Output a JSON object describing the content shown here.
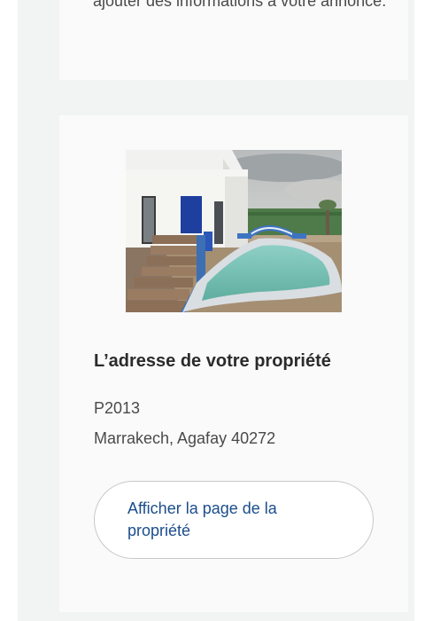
{
  "intro_card": {
    "text": "ajouter des informations à votre annonce."
  },
  "property_card": {
    "photo_alt": "Photo de la propriété",
    "heading": "L’adresse de votre propriété",
    "reference": "P2013",
    "location": "Marrakech, Agafay 40272",
    "view_button_label": "Afficher la page de la propriété"
  },
  "colors": {
    "link": "#1b4d8c",
    "text": "#4a4a4a",
    "heading": "#2b2b2b",
    "card": "#fafafa",
    "column": "#f2f3f3"
  }
}
